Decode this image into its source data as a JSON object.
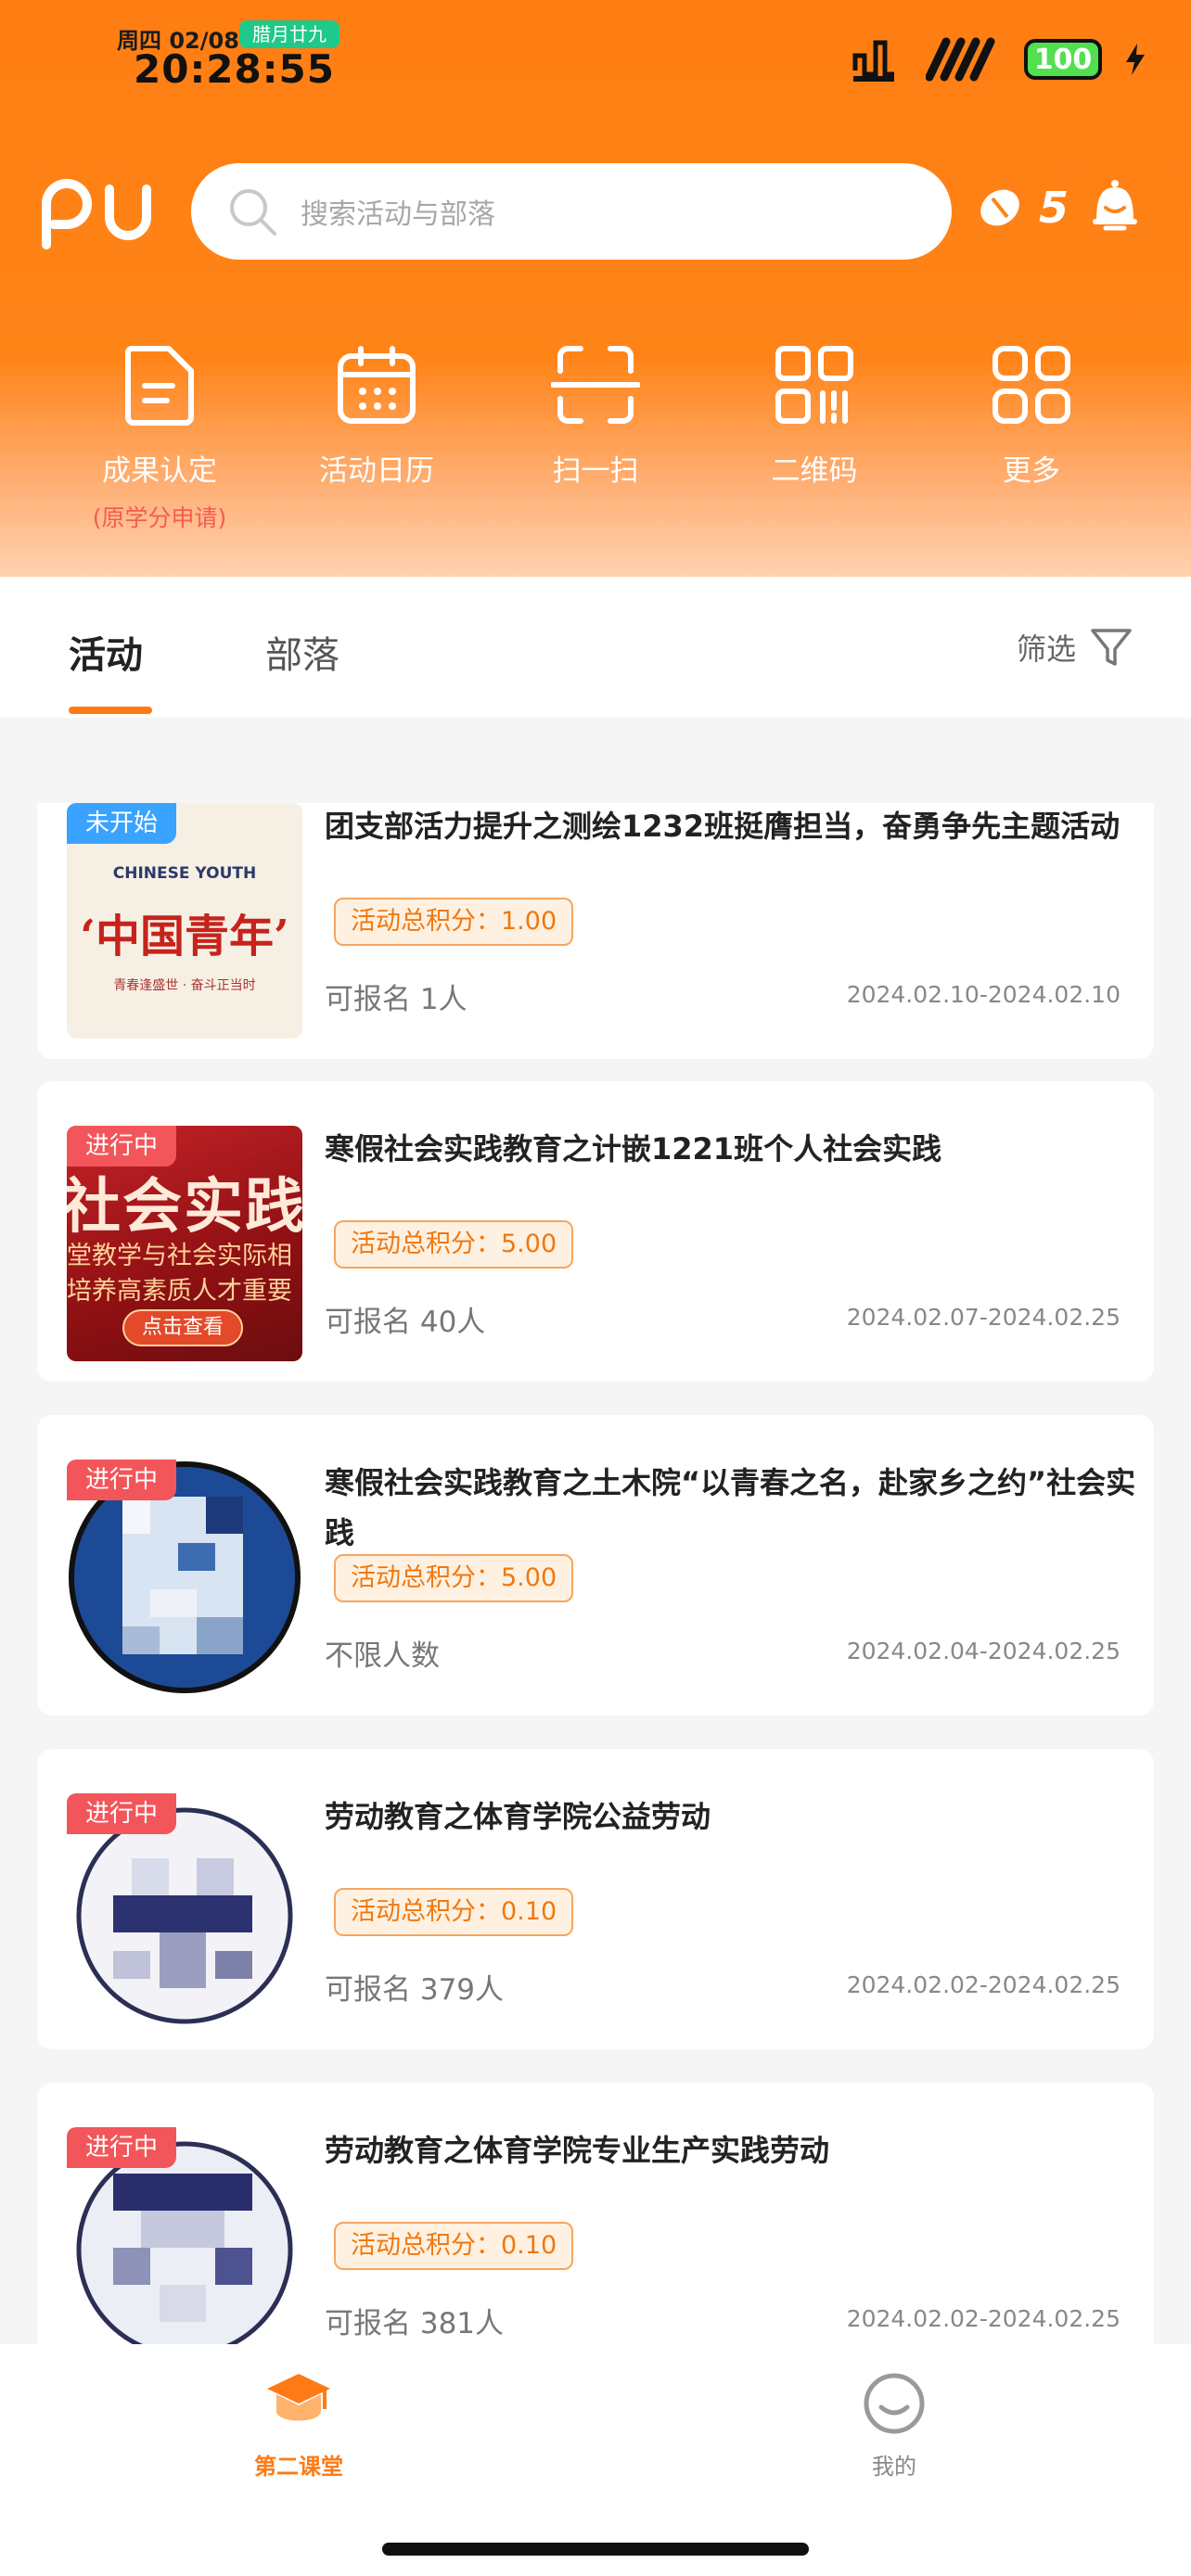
{
  "status_bar": {
    "date": "周四 02/08",
    "lunar_badge": "腊月廿九",
    "time": "20:28:55",
    "battery": "100"
  },
  "search": {
    "placeholder": "搜索活动与部落"
  },
  "coins": {
    "count": "5"
  },
  "quick_actions": [
    {
      "label": "成果认定",
      "sublabel": "(原学分申请)",
      "icon": "document-icon"
    },
    {
      "label": "活动日历",
      "icon": "calendar-icon"
    },
    {
      "label": "扫一扫",
      "icon": "scan-icon"
    },
    {
      "label": "二维码",
      "icon": "qrcode-icon"
    },
    {
      "label": "更多",
      "icon": "grid-icon"
    }
  ],
  "tabs": [
    {
      "label": "活动",
      "active": true
    },
    {
      "label": "部落",
      "active": false
    }
  ],
  "filter": {
    "label": "筛选"
  },
  "activities": [
    {
      "status": "未开始",
      "title": "团支部活力提升之测绘1232班挺膺担当，奋勇争先主题活动",
      "score": "活动总积分：1.00",
      "quota": "可报名 1人",
      "dates": "2024.02.10-2024.02.10",
      "thumb": {
        "en": "CHINESE YOUTH",
        "cn": "‘中国青年’",
        "small": "青春逢盛世 · 奋斗正当时"
      }
    },
    {
      "status": "进行中",
      "title": "寒假社会实践教育之计嵌1221班个人社会实践",
      "score": "活动总积分：5.00",
      "quota": "可报名 40人",
      "dates": "2024.02.07-2024.02.25",
      "thumb": {
        "big": "社会实践",
        "line1": "堂教学与社会实际相",
        "line2": "培养高素质人才重要",
        "btn": "点击查看"
      }
    },
    {
      "status": "进行中",
      "title": "寒假社会实践教育之土木院“以青春之名，赴家乡之约”社会实践",
      "score": "活动总积分：5.00",
      "quota": "不限人数",
      "dates": "2024.02.04-2024.02.25"
    },
    {
      "status": "进行中",
      "title": "劳动教育之体育学院公益劳动",
      "score": "活动总积分：0.10",
      "quota": "可报名 379人",
      "dates": "2024.02.02-2024.02.25"
    },
    {
      "status": "进行中",
      "title": "劳动教育之体育学院专业生产实践劳动",
      "score": "活动总积分：0.10",
      "quota": "可报名 381人",
      "dates": "2024.02.02-2024.02.25"
    }
  ],
  "bottom_nav": [
    {
      "label": "第二课堂",
      "active": true,
      "icon": "graduation-cap-icon"
    },
    {
      "label": "我的",
      "active": false,
      "icon": "smiley-icon"
    }
  ],
  "colors": {
    "brand": "#ff7e13",
    "ongoing": "#f2555a",
    "upcoming": "#3aa2ff",
    "score": "#f07810"
  }
}
